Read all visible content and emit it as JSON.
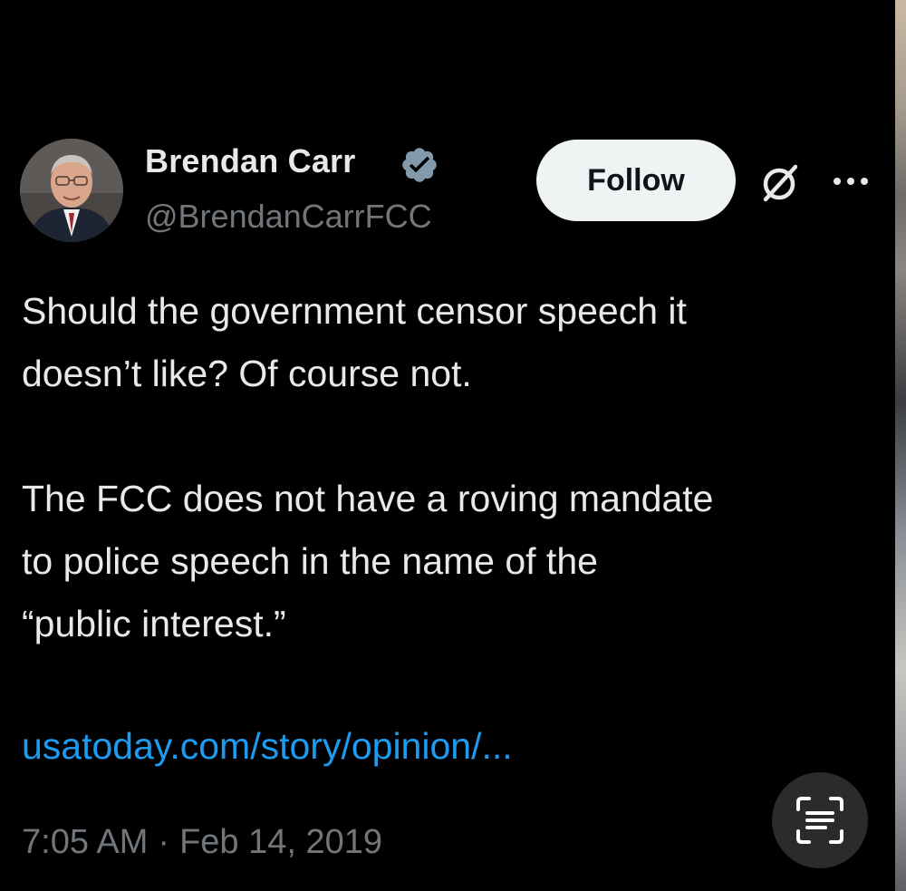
{
  "author": {
    "display_name": "Brendan Carr",
    "handle": "@BrendanCarrFCC",
    "verified": true,
    "avatar_icon": "profile-photo"
  },
  "actions": {
    "follow_label": "Follow",
    "grok_icon": "grok-icon",
    "more_icon": "more-horizontal-icon"
  },
  "tweet": {
    "lines": [
      "Should the government censor speech it",
      "doesn’t like?  Of course not.",
      "The FCC does not have a roving mandate",
      "to police speech in the name of the",
      "“public interest.”"
    ],
    "link_text": "usatoday.com/story/opinion/...",
    "time": "7:05 AM",
    "separator": "·",
    "date": "Feb 14, 2019"
  },
  "overlay": {
    "scan_icon": "text-scan-icon"
  },
  "colors": {
    "background": "#000000",
    "primary_text": "#e7e9ea",
    "secondary_text": "#71767b",
    "link": "#1d9bf0",
    "verified": "#829aab",
    "follow_bg": "#eff3f4"
  }
}
